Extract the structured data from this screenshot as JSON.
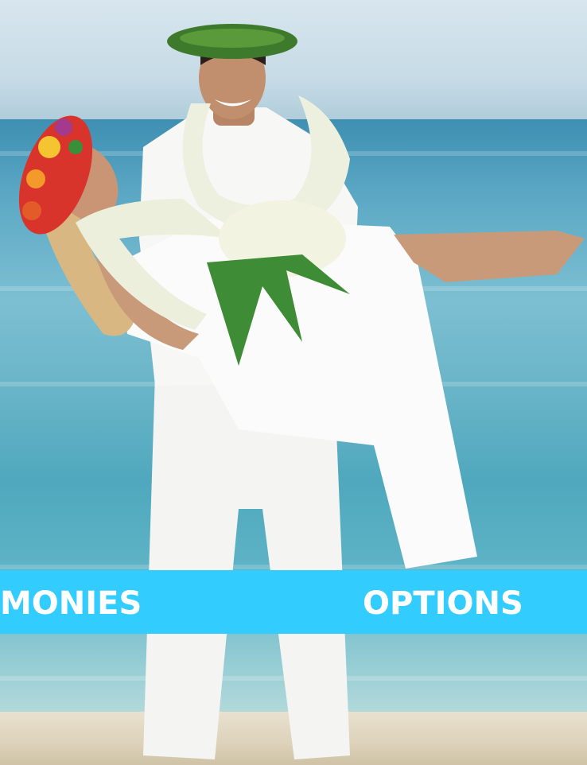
{
  "photo": {
    "subject": "wedding-couple-beach-photo"
  },
  "menu": {
    "background_color": "#33ccff",
    "text_color": "#ffffff",
    "items": [
      {
        "label": "MONIES"
      },
      {
        "label": "OPTIONS"
      }
    ]
  }
}
